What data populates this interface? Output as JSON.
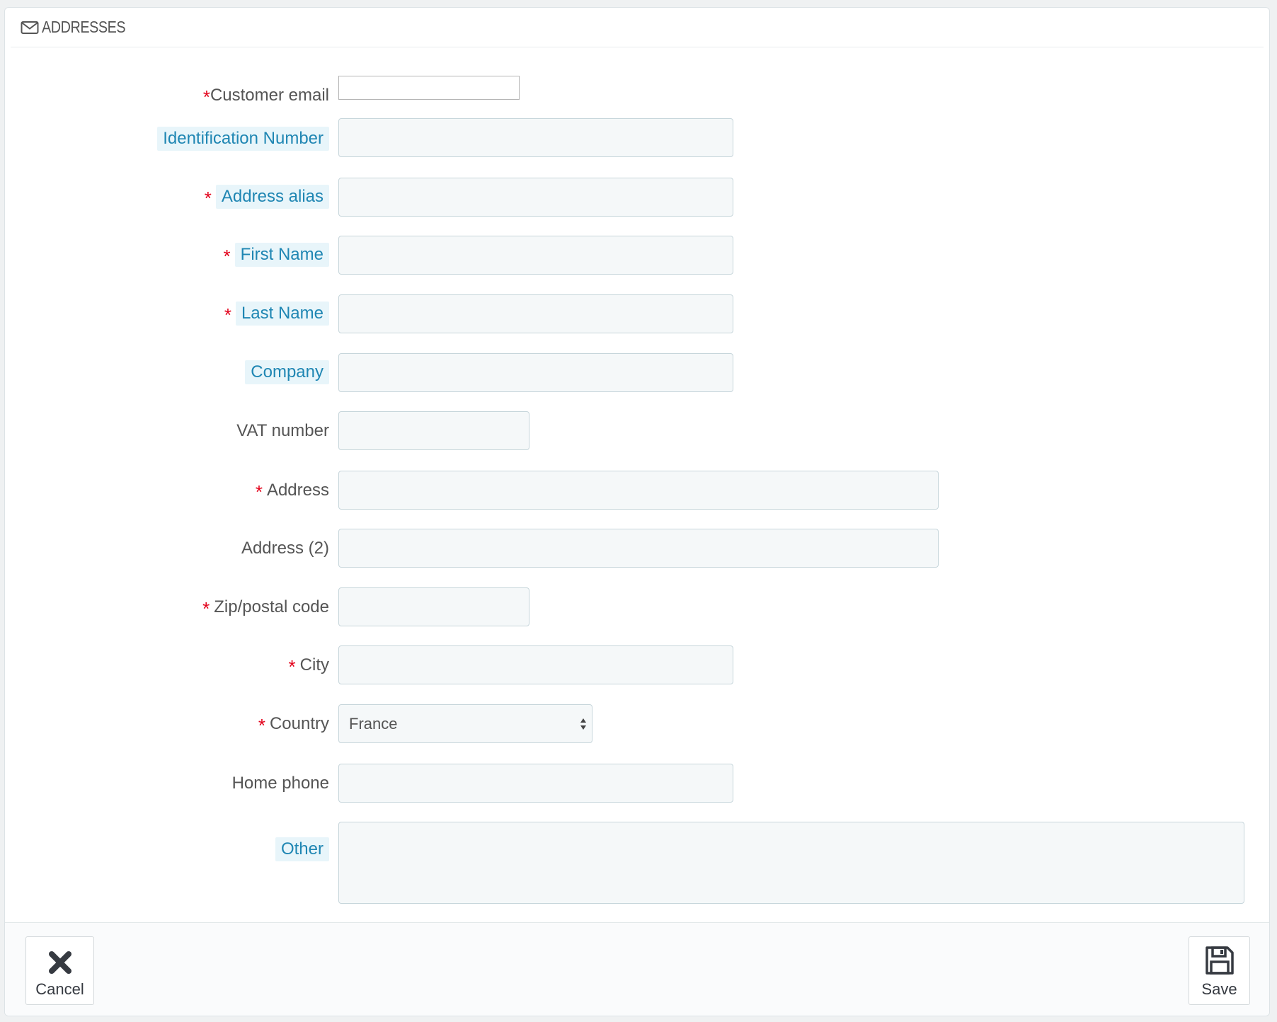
{
  "panel": {
    "title": "ADDRESSES",
    "icon": "envelope-icon"
  },
  "form": {
    "customer_email": {
      "label": "Customer email",
      "required": true,
      "value": ""
    },
    "identification_number": {
      "label": "Identification Number",
      "required": false,
      "value": ""
    },
    "address_alias": {
      "label": "Address alias",
      "required": true,
      "value": ""
    },
    "first_name": {
      "label": "First Name",
      "required": true,
      "value": ""
    },
    "last_name": {
      "label": "Last Name",
      "required": true,
      "value": ""
    },
    "company": {
      "label": "Company",
      "required": false,
      "value": ""
    },
    "vat_number": {
      "label": "VAT number",
      "required": false,
      "value": ""
    },
    "address": {
      "label": "Address",
      "required": true,
      "value": ""
    },
    "address2": {
      "label": "Address (2)",
      "required": false,
      "value": ""
    },
    "zip": {
      "label": "Zip/postal code",
      "required": true,
      "value": ""
    },
    "city": {
      "label": "City",
      "required": true,
      "value": ""
    },
    "country": {
      "label": "Country",
      "required": true,
      "selected": "France"
    },
    "home_phone": {
      "label": "Home phone",
      "required": false,
      "value": ""
    },
    "other": {
      "label": "Other",
      "required": false,
      "value": ""
    },
    "required_marker": "*"
  },
  "footer": {
    "cancel_label": "Cancel",
    "save_label": "Save"
  },
  "colors": {
    "required": "#e3021b",
    "hint_text": "#1f86b3",
    "hint_bg": "#e8f5fa",
    "input_bg": "#f5f8f9",
    "input_border": "#c7d6db"
  }
}
